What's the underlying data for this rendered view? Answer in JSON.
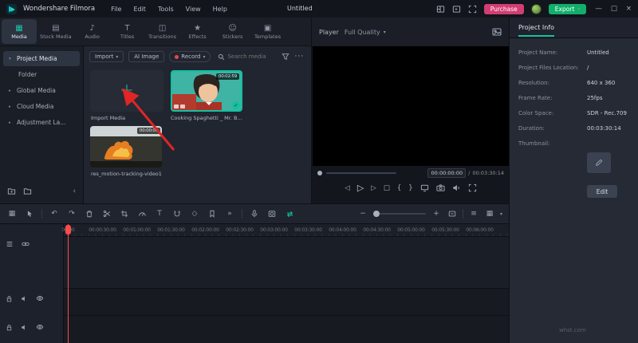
{
  "icons": {
    "caret_down": "▾",
    "caret_right": "▸",
    "caret_left": "‹",
    "minimize": "—",
    "maximize": "□",
    "close": "×",
    "undo": "↶",
    "redo": "↷",
    "keyframe": "◇",
    "chevrons": "»",
    "more": "···",
    "zoom_out": "−",
    "zoom_in": "+",
    "grid": "▦",
    "list": "≡",
    "text_tool": "T",
    "plus": "+",
    "check": "✓"
  },
  "topbar": {
    "app_name": "Wondershare Filmora",
    "menus": [
      "File",
      "Edit",
      "Tools",
      "View",
      "Help"
    ],
    "project_title": "Untitled",
    "purchase_label": "Purchase",
    "export_label": "Export"
  },
  "tabs": {
    "items": [
      {
        "label": "Media",
        "glyph": "▦"
      },
      {
        "label": "Stock Media",
        "glyph": "▤"
      },
      {
        "label": "Audio",
        "glyph": "♪"
      },
      {
        "label": "Titles",
        "glyph": "T"
      },
      {
        "label": "Transitions",
        "glyph": "◫"
      },
      {
        "label": "Effects",
        "glyph": "★"
      },
      {
        "label": "Stickers",
        "glyph": "☺"
      },
      {
        "label": "Templates",
        "glyph": "▣"
      }
    ]
  },
  "player": {
    "label": "Player",
    "quality": "Full Quality",
    "timecode_current": "00:00:00:00",
    "timecode_separator": "/",
    "timecode_total": "00:03:30:14",
    "controls": {
      "prev": "◁",
      "play": "▷",
      "next": "▷",
      "stop": "□",
      "mark_in": "{",
      "mark_out": "}"
    }
  },
  "sidebar": {
    "items": [
      {
        "label": "Project Media",
        "caret": "▾"
      },
      {
        "label": "Folder",
        "caret": ""
      },
      {
        "label": "Global Media",
        "caret": "▸"
      },
      {
        "label": "Cloud Media",
        "caret": "▸"
      },
      {
        "label": "Adjustment La...",
        "caret": "▸"
      }
    ]
  },
  "media_toolbar": {
    "import_label": "Import",
    "ai_image_label": "AI Image",
    "record_label": "Record",
    "search_placeholder": "Search media"
  },
  "media_items": [
    {
      "name": "Import Media"
    },
    {
      "name": "Cooking Spaghetti _ Mr. Bea...",
      "duration": "00:02:59"
    },
    {
      "name": "res_motion-tracking-video1",
      "duration": "00:00:06"
    }
  ],
  "project_info": {
    "title": "Project Info",
    "fields": [
      [
        "Project Name:",
        "Untitled"
      ],
      [
        "Project Files Location:",
        "/"
      ],
      [
        "Resolution:",
        "640 x 360"
      ],
      [
        "Frame Rate:",
        "25fps"
      ],
      [
        "Color Space:",
        "SDR - Rec.709"
      ],
      [
        "Duration:",
        "00:03:30:14"
      ],
      [
        "Thumbnail:",
        ""
      ]
    ],
    "edit_label": "Edit"
  },
  "timeline": {
    "ruler_labels": [
      "00:00",
      "00:00:30:00",
      "00:01:00:00",
      "00:01:30:00",
      "00:02:00:00",
      "00:02:30:00",
      "00:03:00:00",
      "00:03:30:00",
      "00:04:00:00",
      "00:04:30:00",
      "00:05:00:00",
      "00:05:30:00",
      "00:06:00:00"
    ]
  },
  "watermark": "whst.com",
  "colors": {
    "accent": "#14c0a2",
    "purchase": "#d23d72",
    "export": "#10b06b",
    "playhead": "#ff4a4a",
    "annotation_arrow": "#e02525"
  }
}
